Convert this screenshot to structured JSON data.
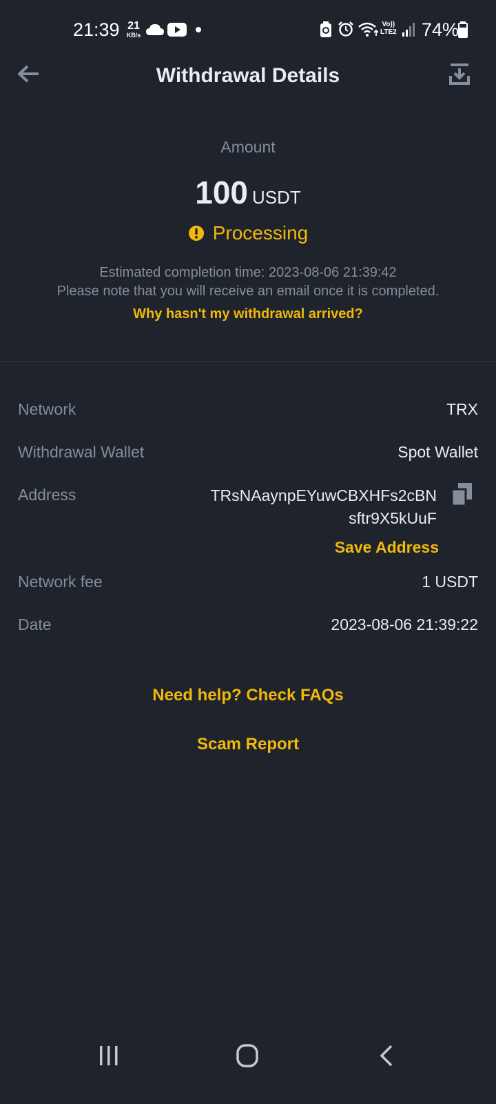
{
  "status_bar": {
    "time": "21:39",
    "net_speed_value": "21",
    "net_speed_unit": "KB/s",
    "volte_top": "Vo))",
    "volte_bottom": "LTE2",
    "battery_percent": "74%",
    "icons": [
      "cloud-icon",
      "youtube-icon",
      "dot-icon",
      "battery-saver-icon",
      "alarm-icon",
      "wifi-icon",
      "signal-icon",
      "battery-icon"
    ]
  },
  "header": {
    "title": "Withdrawal Details",
    "back_icon": "arrow-left-icon",
    "export_icon": "download-export-icon"
  },
  "summary": {
    "amount_label": "Amount",
    "amount_value": "100",
    "amount_unit": "USDT",
    "status": "Processing",
    "status_icon": "warning-circle-icon",
    "estimated_completion": "Estimated completion time: 2023-08-06 21:39:42",
    "email_note": "Please note that you will receive an email once it is completed.",
    "why_link": "Why hasn't my withdrawal arrived?"
  },
  "details": {
    "network_label": "Network",
    "network_value": "TRX",
    "wallet_label": "Withdrawal Wallet",
    "wallet_value": "Spot Wallet",
    "address_label": "Address",
    "address_line1": "TRsNAaynpEYuwCBXHFs2cBN",
    "address_line2": "sftr9X5kUuF",
    "copy_icon": "copy-icon",
    "save_address": "Save Address",
    "fee_label": "Network fee",
    "fee_value": "1 USDT",
    "date_label": "Date",
    "date_value": "2023-08-06 21:39:22"
  },
  "links": {
    "faq": "Need help? Check FAQs",
    "scam": "Scam Report"
  },
  "nav_bar": {
    "icons": [
      "recent-apps-icon",
      "home-icon",
      "back-icon"
    ]
  },
  "colors": {
    "background": "#1f232b",
    "accent": "#f0b90b",
    "text_primary": "#eaecef",
    "text_secondary": "#848e9c"
  }
}
